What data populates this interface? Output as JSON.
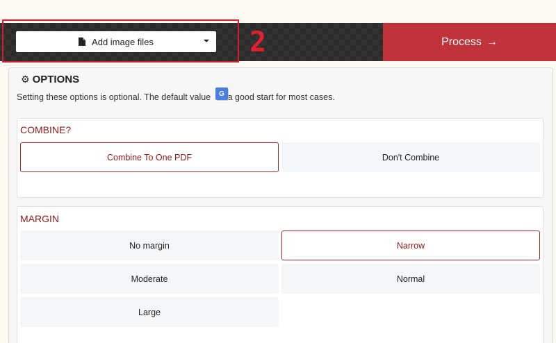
{
  "toolbar": {
    "add_files_label": "Add image files",
    "step_number": "2",
    "process_label": "Process",
    "process_arrow": "→"
  },
  "options": {
    "gear_glyph": "⚙",
    "title": "OPTIONS",
    "description": "Setting these options is optional. The default value",
    "description_tail": "e a good start for most cases.",
    "translate_glyph": "G"
  },
  "combine": {
    "title": "COMBINE?",
    "options": [
      "Combine To One PDF",
      "Don't Combine"
    ],
    "selected": "Combine To One PDF"
  },
  "margin": {
    "title": "MARGIN",
    "options": [
      "No margin",
      "Narrow",
      "Moderate",
      "Normal",
      "Large"
    ],
    "selected": "Narrow"
  },
  "colors": {
    "accent": "#c0333a",
    "selected_text": "#8b1a1a",
    "highlight": "#d81b2a"
  }
}
